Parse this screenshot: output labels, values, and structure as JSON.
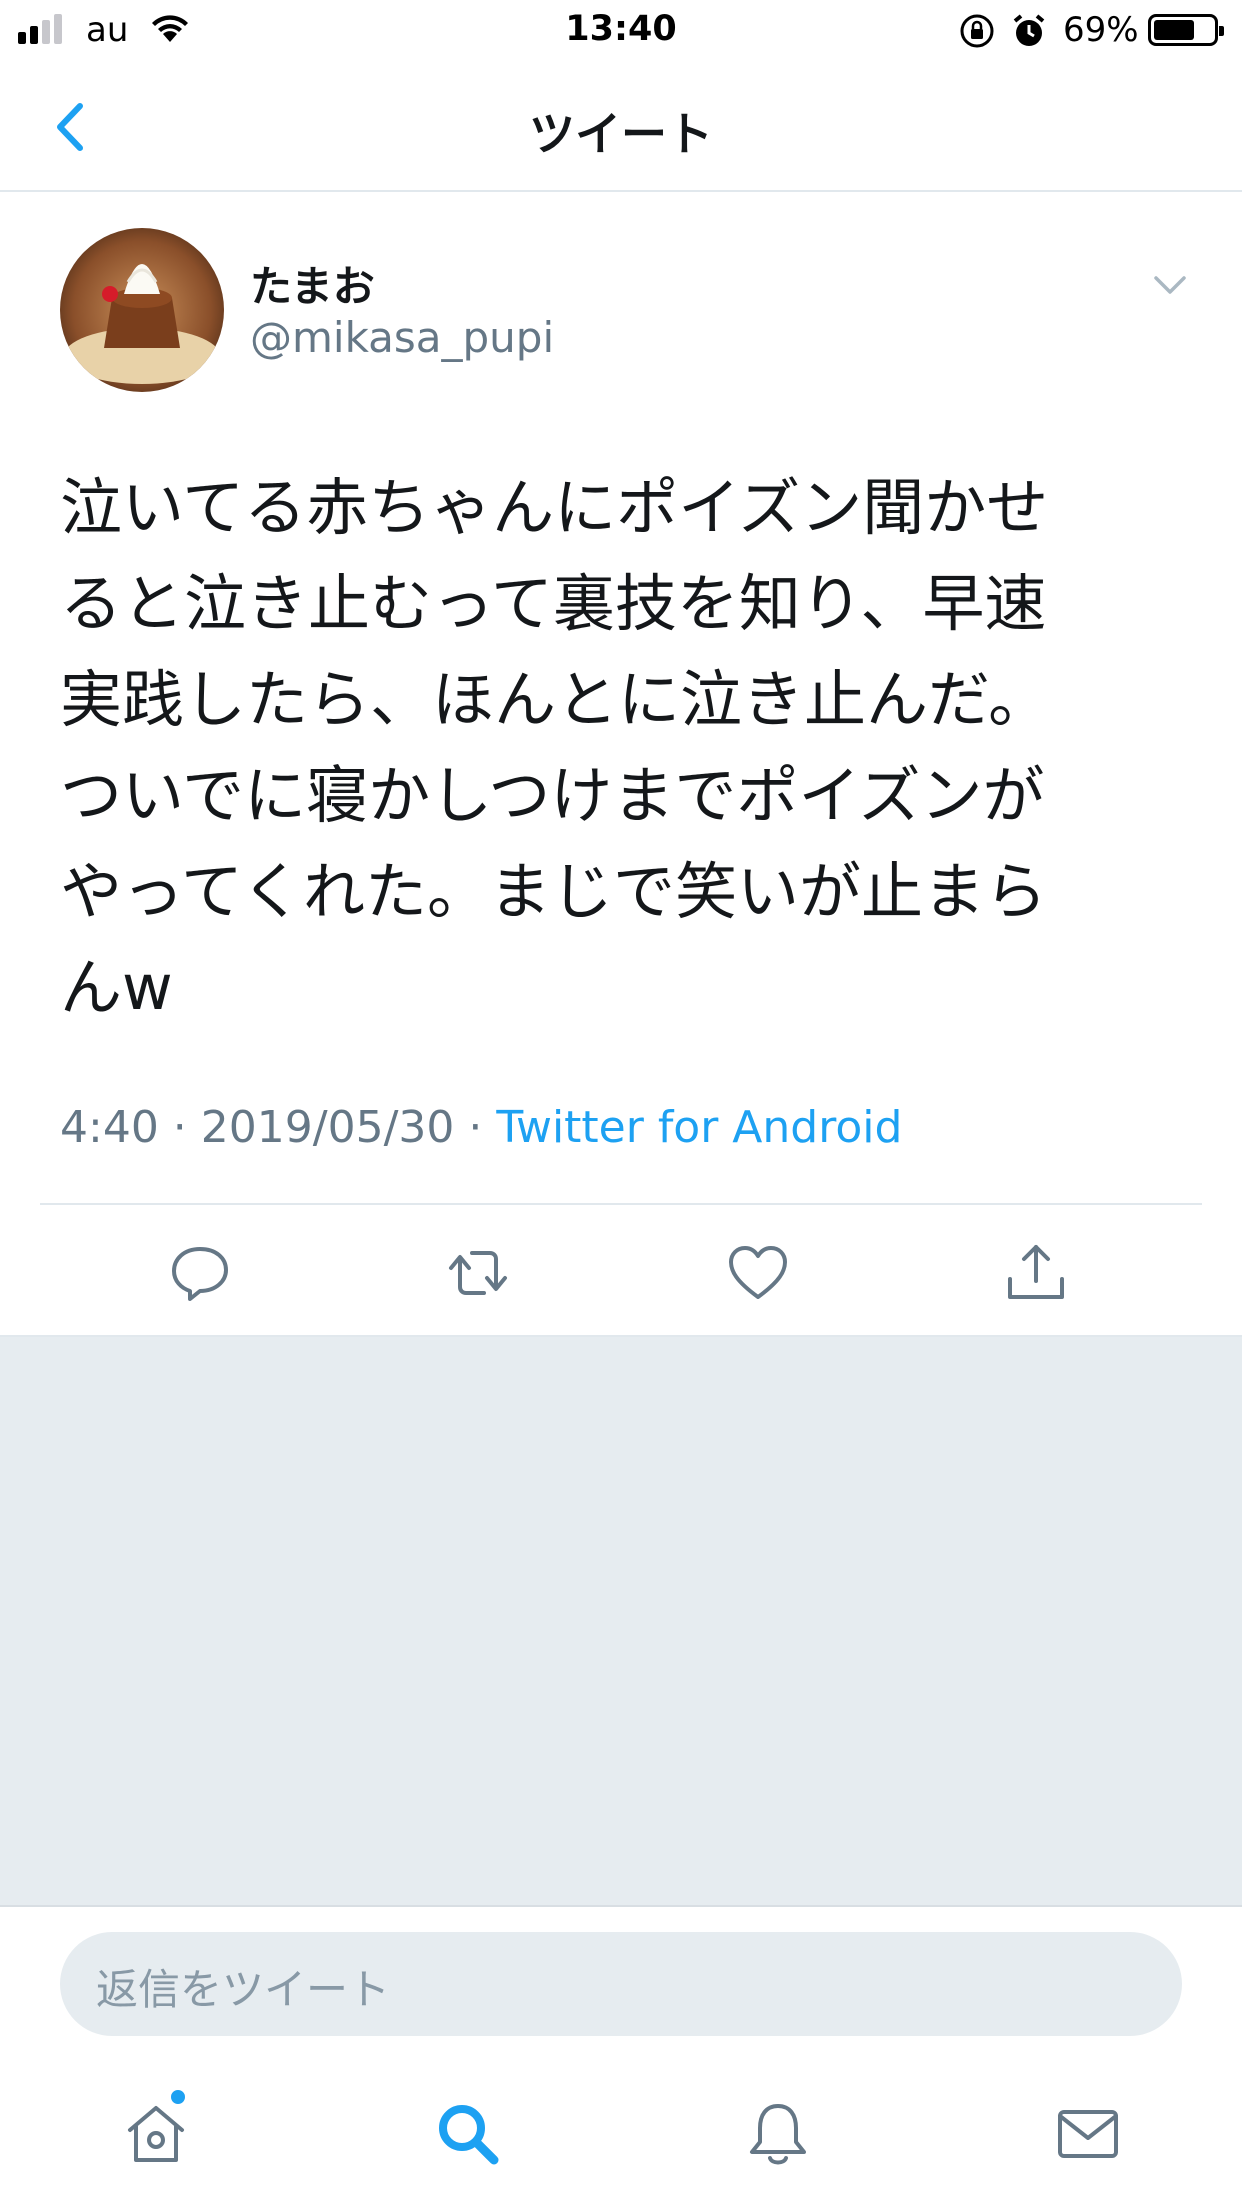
{
  "status_bar": {
    "carrier": "au",
    "time": "13:40",
    "battery_percent": "69%",
    "battery_level": 0.69,
    "signal_bars_filled": 2,
    "signal_bars_total": 4
  },
  "header": {
    "title": "ツイート",
    "back_icon": "chevron-left-icon"
  },
  "tweet": {
    "display_name": "たまお",
    "handle": "@mikasa_pupi",
    "text": "泣いてる赤ちゃんにポイズン聞かせ\nると泣き止むって裏技を知り、早速\n実践したら、ほんとに泣き止んだ。\nついでに寝かしつけまでポイズンが\nやってくれた。まじで笑いが止まら\nんw",
    "time": "4:40",
    "date": "2019/05/30",
    "separator": " · ",
    "source": "Twitter for Android"
  },
  "actions": {
    "icons": [
      "reply-icon",
      "retweet-icon",
      "like-icon",
      "share-icon"
    ]
  },
  "reply": {
    "placeholder": "返信をツイート"
  },
  "tabbar": {
    "icons": [
      "home-icon",
      "search-icon",
      "notifications-icon",
      "messages-icon"
    ],
    "active": "search-icon"
  },
  "colors": {
    "accent": "#1da1f2",
    "text_primary": "#14171a",
    "text_secondary": "#657786",
    "background_gray": "#e6ecf0"
  }
}
